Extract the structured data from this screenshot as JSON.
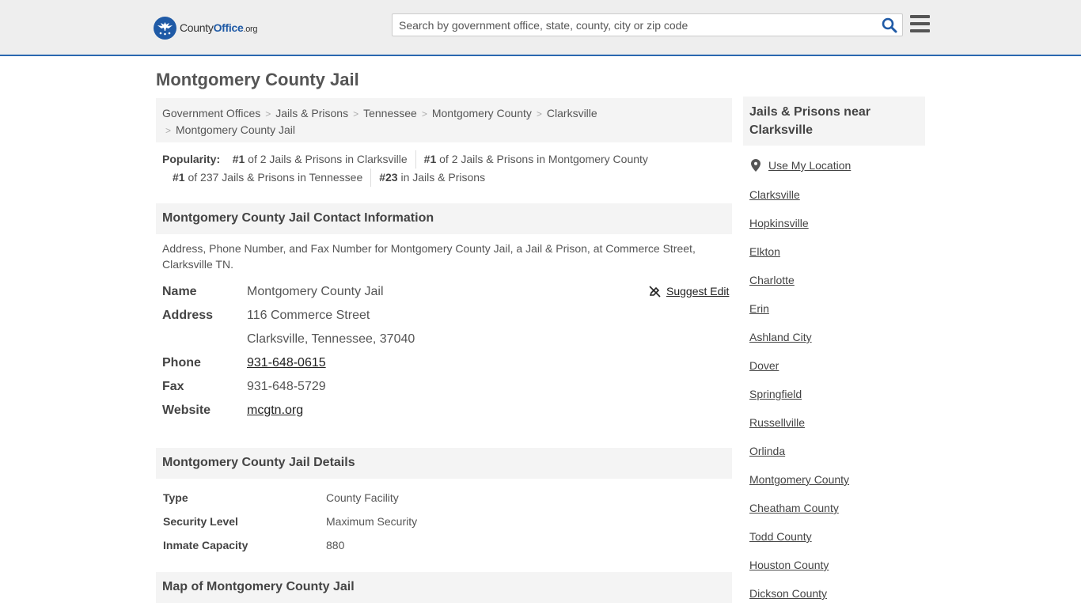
{
  "header": {
    "logo_text_county": "County",
    "logo_text_office": "Office",
    "logo_text_org": ".org",
    "search_placeholder": "Search by government office, state, county, city or zip code",
    "accent_color": "#2a68b0"
  },
  "page_title": "Montgomery County Jail",
  "breadcrumb": [
    "Government Offices",
    "Jails & Prisons",
    "Tennessee",
    "Montgomery County",
    "Clarksville",
    "Montgomery County Jail"
  ],
  "popularity": {
    "label": "Popularity:",
    "items": [
      {
        "rank": "#1",
        "text": " of 2 Jails & Prisons in Clarksville"
      },
      {
        "rank": "#1",
        "text": " of 2 Jails & Prisons in Montgomery County"
      },
      {
        "rank": "#1",
        "text": " of 237 Jails & Prisons in Tennessee"
      },
      {
        "rank": "#23",
        "text": " in Jails & Prisons"
      }
    ]
  },
  "contact": {
    "heading": "Montgomery County Jail Contact Information",
    "description": "Address, Phone Number, and Fax Number for Montgomery County Jail, a Jail & Prison, at Commerce Street, Clarksville TN.",
    "suggest_edit": "Suggest Edit",
    "name_label": "Name",
    "name": "Montgomery County Jail",
    "address_label": "Address",
    "address_line1": "116 Commerce Street",
    "address_line2": "Clarksville, Tennessee, 37040",
    "phone_label": "Phone",
    "phone": "931-648-0615",
    "fax_label": "Fax",
    "fax": "931-648-5729",
    "website_label": "Website",
    "website": "mcgtn.org"
  },
  "details": {
    "heading": "Montgomery County Jail Details",
    "rows": [
      {
        "label": "Type",
        "value": "County Facility"
      },
      {
        "label": "Security Level",
        "value": "Maximum Security"
      },
      {
        "label": "Inmate Capacity",
        "value": "880"
      }
    ]
  },
  "map": {
    "heading": "Map of Montgomery County Jail"
  },
  "sidebar": {
    "heading": "Jails & Prisons near Clarksville",
    "use_location": "Use My Location",
    "links": [
      "Clarksville",
      "Hopkinsville",
      "Elkton",
      "Charlotte",
      "Erin",
      "Ashland City",
      "Dover",
      "Springfield",
      "Russellville",
      "Orlinda",
      "Montgomery County",
      "Cheatham County",
      "Todd County",
      "Houston County",
      "Dickson County"
    ]
  }
}
